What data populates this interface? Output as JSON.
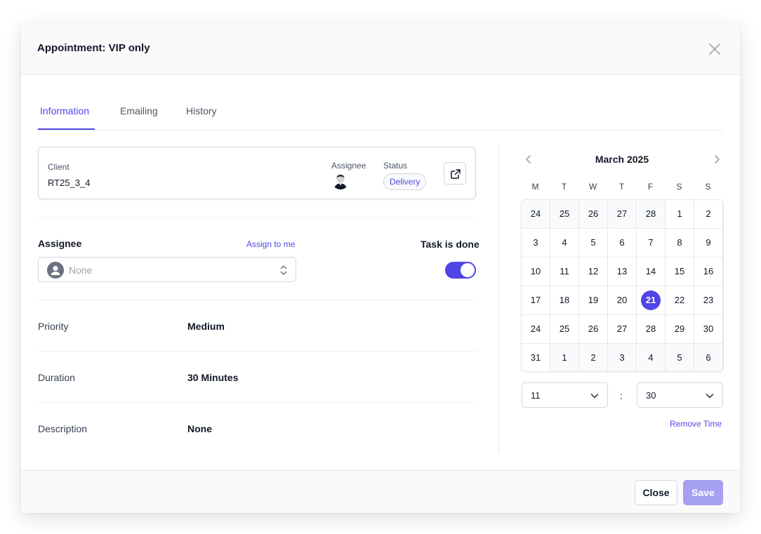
{
  "modal": {
    "title": "Appointment: VIP only"
  },
  "tabs": [
    {
      "label": "Information"
    },
    {
      "label": "Emailing"
    },
    {
      "label": "History"
    }
  ],
  "client_card": {
    "client_label": "Client",
    "client_value": "RT25_3_4",
    "assignee_label": "Assignee",
    "status_label": "Status",
    "status_value": "Delivery"
  },
  "assignee": {
    "label": "Assignee",
    "assign_to_me": "Assign to me",
    "placeholder": "None"
  },
  "task": {
    "label": "Task is done",
    "done": true
  },
  "details": [
    {
      "label": "Priority",
      "value": "Medium"
    },
    {
      "label": "Duration",
      "value": "30 Minutes"
    },
    {
      "label": "Description",
      "value": "None"
    }
  ],
  "calendar": {
    "month_label": "March 2025",
    "weekdays": [
      "M",
      "T",
      "W",
      "T",
      "F",
      "S",
      "S"
    ],
    "weeks": [
      [
        "24",
        "25",
        "26",
        "27",
        "28",
        "1",
        "2"
      ],
      [
        "3",
        "4",
        "5",
        "6",
        "7",
        "8",
        "9"
      ],
      [
        "10",
        "11",
        "12",
        "13",
        "14",
        "15",
        "16"
      ],
      [
        "17",
        "18",
        "19",
        "20",
        "21",
        "22",
        "23"
      ],
      [
        "24",
        "25",
        "26",
        "27",
        "28",
        "29",
        "30"
      ],
      [
        "31",
        "1",
        "2",
        "3",
        "4",
        "5",
        "6"
      ]
    ],
    "selected_day": "21"
  },
  "time": {
    "hour": "11",
    "separator": ":",
    "minute": "30",
    "remove_label": "Remove Time"
  },
  "footer": {
    "close_label": "Close",
    "save_label": "Save"
  },
  "colors": {
    "accent": "#4f46e5",
    "save_disabled": "#a5a1f0"
  }
}
